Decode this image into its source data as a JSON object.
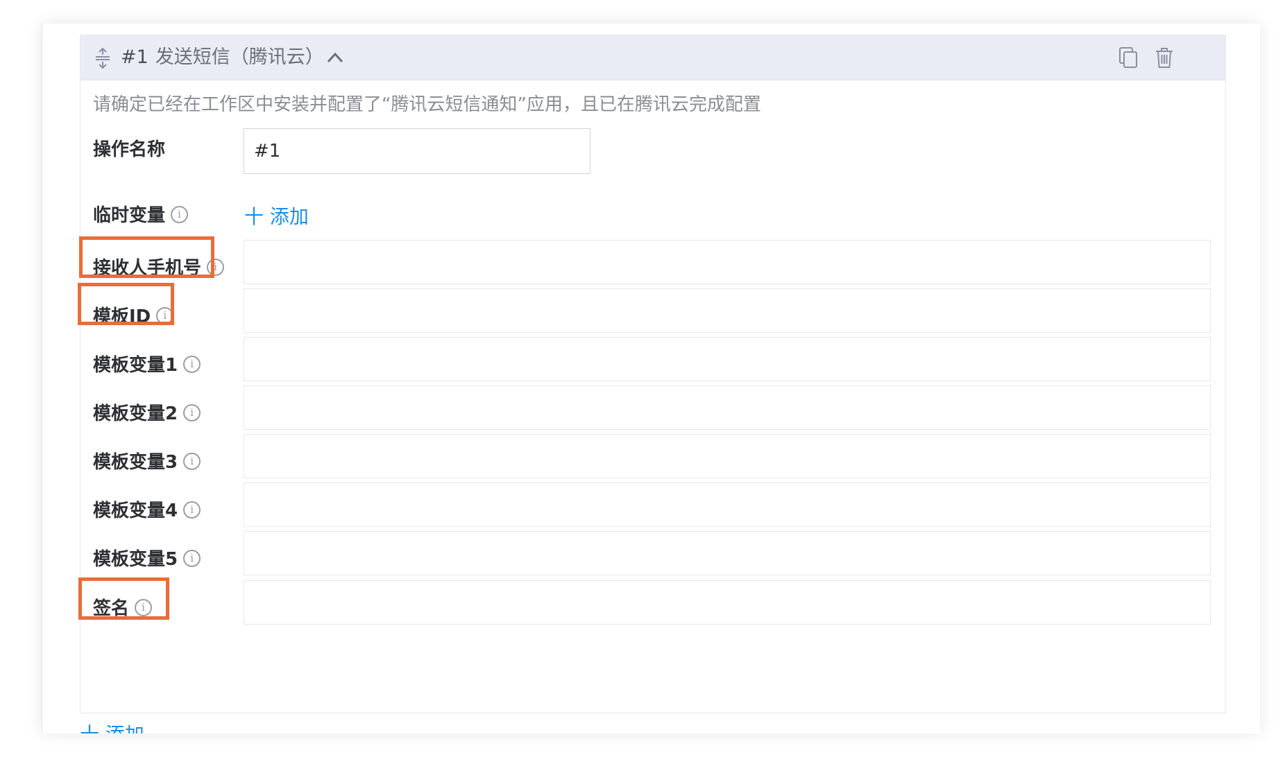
{
  "action": {
    "index_label": "#1",
    "title": "发送短信（腾讯云）",
    "notice": "请确定已经在工作区中安装并配置了“腾讯云短信通知”应用，且已在腾讯云完成配置",
    "name_field": {
      "label": "操作名称",
      "value": "#1"
    },
    "temp_vars": {
      "label": "临时变量",
      "add_label": "十 添加"
    },
    "fields": [
      {
        "label": "接收人手机号",
        "value": ""
      },
      {
        "label": "模板ID",
        "value": ""
      },
      {
        "label": "模板变量1",
        "value": ""
      },
      {
        "label": "模板变量2",
        "value": ""
      },
      {
        "label": "模板变量3",
        "value": ""
      },
      {
        "label": "模板变量4",
        "value": ""
      },
      {
        "label": "模板变量5",
        "value": ""
      },
      {
        "label": "签名",
        "value": ""
      }
    ],
    "info_glyph": "i"
  },
  "footer": {
    "add_label": "十 添加"
  },
  "colors": {
    "header_bg": "#e9ecf4",
    "link": "#1b8ee6",
    "highlight": "#ea6c3a"
  },
  "icons": {
    "drag": "drag-handle-icon",
    "collapse": "chevron-up-icon",
    "copy": "copy-icon",
    "delete": "trash-icon",
    "info": "info-icon"
  }
}
